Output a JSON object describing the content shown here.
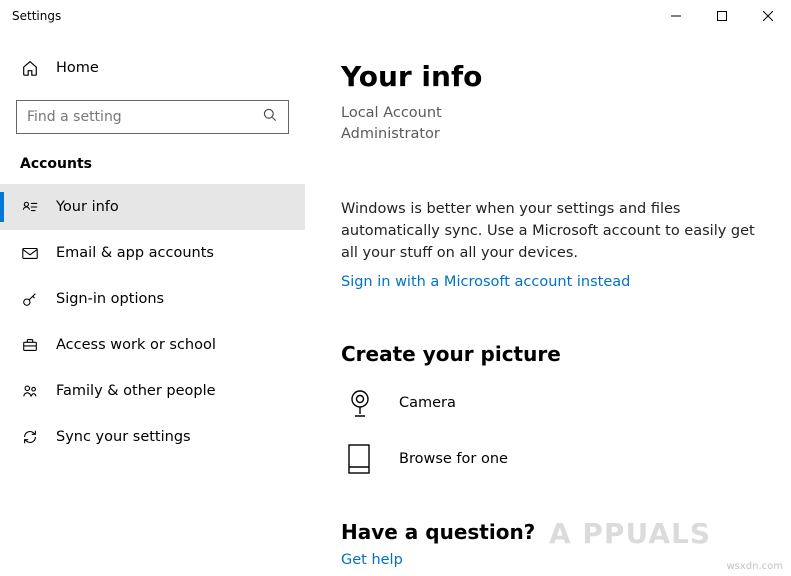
{
  "window": {
    "title": "Settings"
  },
  "sidebar": {
    "home": "Home",
    "search_placeholder": "Find a setting",
    "category": "Accounts",
    "items": [
      {
        "icon": "user-card-icon",
        "label": "Your info",
        "selected": true
      },
      {
        "icon": "mail-icon",
        "label": "Email & app accounts"
      },
      {
        "icon": "key-icon",
        "label": "Sign-in options"
      },
      {
        "icon": "briefcase-icon",
        "label": "Access work or school"
      },
      {
        "icon": "people-icon",
        "label": "Family & other people"
      },
      {
        "icon": "sync-icon",
        "label": "Sync your settings"
      }
    ]
  },
  "main": {
    "title": "Your info",
    "account_type": "Local Account",
    "role": "Administrator",
    "sync_text": "Windows is better when your settings and files automatically sync. Use a Microsoft account to easily get all your stuff on all your devices.",
    "sign_in_link": "Sign in with a Microsoft account instead",
    "picture_header": "Create your picture",
    "picture_options": [
      {
        "icon": "camera-icon",
        "label": "Camera"
      },
      {
        "icon": "browse-icon",
        "label": "Browse for one"
      }
    ],
    "question_header": "Have a question?",
    "help_link": "Get help"
  },
  "watermark": "A  PPUALS",
  "attribution": "wsxdn.com"
}
